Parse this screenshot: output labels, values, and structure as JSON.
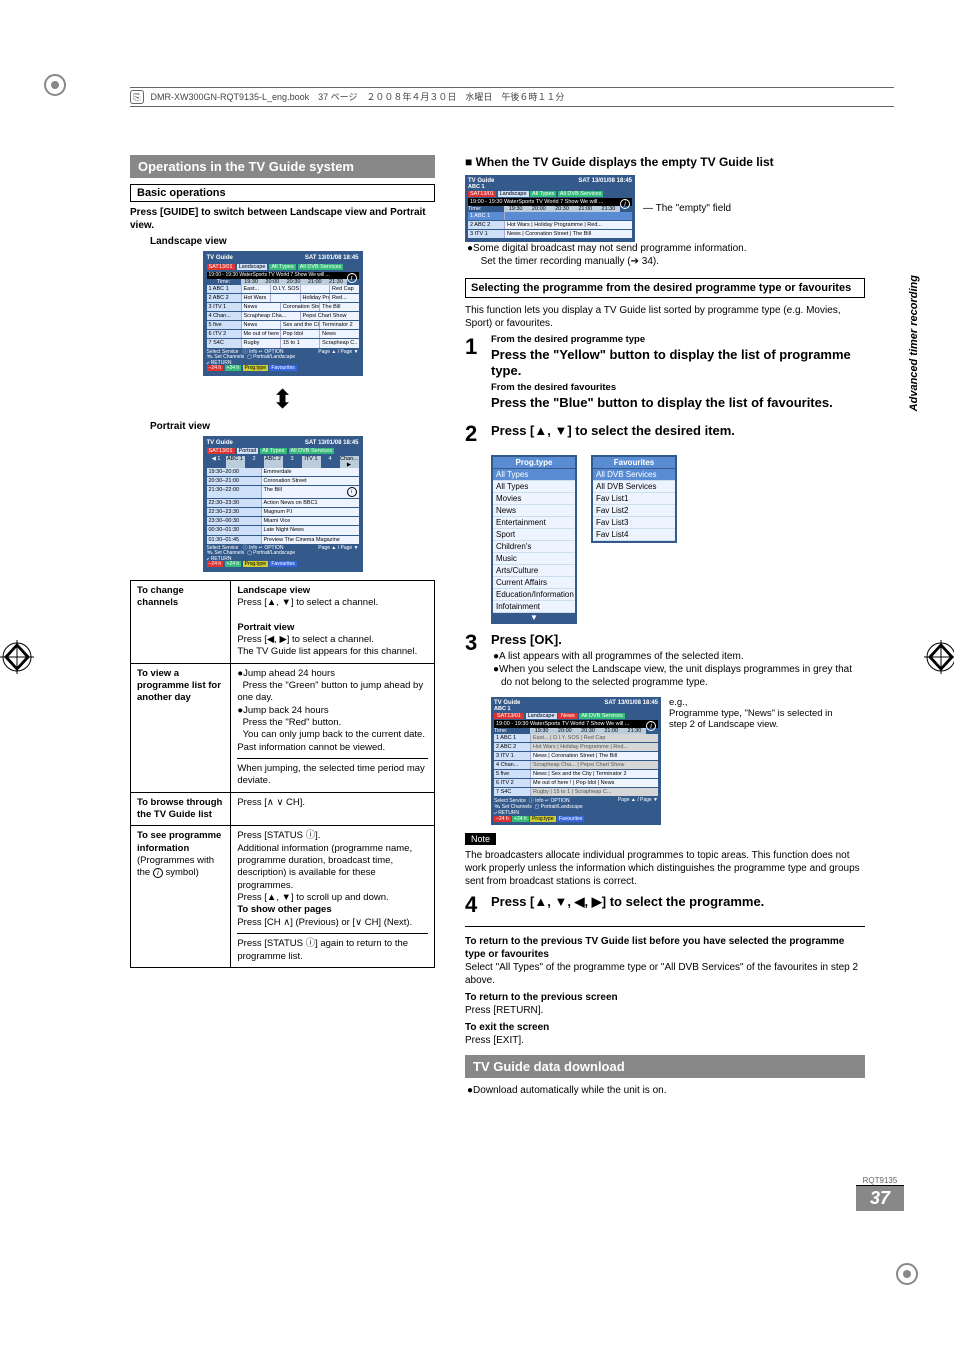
{
  "header_strip": "DMR-XW300GN-RQT9135-L_eng.book　37 ページ　２００８年４月３０日　水曜日　午後６時１１分",
  "side_label": "Advanced timer recording",
  "rqt": "RQT9135",
  "page_num": "37",
  "left": {
    "title": "Operations in the TV Guide system",
    "basic_ops": "Basic operations",
    "press_guide": "Press [GUIDE] to switch between Landscape view and Portrait view.",
    "landscape_label": "Landscape view",
    "portrait_label": "Portrait view",
    "table": {
      "r1l": "To change channels",
      "r1a_h": "Landscape view",
      "r1a": "Press [▲, ▼] to select a channel.",
      "r1b_h": "Portrait view",
      "r1b": "Press [◀, ▶] to select a channel.",
      "r1c": "The TV Guide list appears for this channel.",
      "r2l": "To view a programme list for another day",
      "r2a": "Jump ahead 24 hours",
      "r2b": "Press the \"Green\" button to jump ahead by one day.",
      "r2c": "Jump back 24 hours",
      "r2d": "Press the \"Red\" button.",
      "r2e": "You can only jump back to the current date. Past information cannot be viewed.",
      "r2f": "When jumping, the selected time period may deviate.",
      "r3l": "To browse through the TV Guide list",
      "r3r": "Press [∧ ∨ CH].",
      "r4l": "To see programme information (Programmes with the ⓘ symbol)",
      "r4a": "Press [STATUS ⓘ].",
      "r4b": "Additional information (programme name, programme duration, broadcast time, description) is available for these programmes.",
      "r4c": "Press [▲, ▼] to scroll up and down.",
      "r4d": "To show other pages",
      "r4e": "Press [CH ∧] (Previous) or [∨ CH] (Next).",
      "r4f": "Press [STATUS ⓘ] again to return to the programme list."
    }
  },
  "tg_landscape": {
    "title": "TV Guide",
    "datetime": "SAT 13/01/08 18:45",
    "filter_date": "SAT13/01",
    "filter_view": "Landscape",
    "filter_type": "All Types",
    "filter_svc": "All DVB Services",
    "info_line": "19:00 - 19:30 WaterSports TV World 7 Show We will ...",
    "time_label": "Time:",
    "times": [
      "19:30",
      "20:00",
      "20:30",
      "21:00",
      "21:30"
    ],
    "rows": [
      {
        "n": "1",
        "ch": "ABC 1",
        "p": [
          "East...",
          "D.I.Y. SOS",
          "",
          "Red Cap"
        ]
      },
      {
        "n": "2",
        "ch": "ABC 2",
        "p": [
          "Hot Wars",
          "",
          "Holiday Programme",
          "Red..."
        ]
      },
      {
        "n": "3",
        "ch": "ITV 1",
        "p": [
          "News",
          "Coronation Street",
          "The Bill"
        ]
      },
      {
        "n": "4",
        "ch": "Chan...",
        "p": [
          "Scrapheap Cha...",
          "Pepsi Chart Show"
        ]
      },
      {
        "n": "5",
        "ch": "five",
        "p": [
          "News",
          "Sex and the City",
          "Terminator 2"
        ]
      },
      {
        "n": "6",
        "ch": "ITV 2",
        "p": [
          "Me out of here !",
          "Pop Idol",
          "News"
        ]
      },
      {
        "n": "7",
        "ch": "S4C",
        "p": [
          "Rugby",
          "15 to 1",
          "Scrapheap C..."
        ]
      }
    ],
    "ftr1": "Select Service",
    "ftr2": "Set Channels",
    "ftr_info": "ⓘ Info  ↵ OPTION",
    "ftr_view": "▢ Portrait/Landscape",
    "ftr_page": "Page ▲ / Page ▼",
    "ftr_return": "⤶ RETURN",
    "btn_m24": "−24 h",
    "btn_p24": "+24 h",
    "btn_pt": "Prog.type",
    "btn_fav": "Favourites"
  },
  "tg_portrait": {
    "title": "TV Guide",
    "datetime": "SAT 13/01/08 18:45",
    "filter_date": "SAT13/01",
    "filter_view": "Portrait",
    "filter_type": "All Types",
    "filter_svc": "All DVB Services",
    "ch_row": [
      "◀ 1",
      "ABC 1",
      "2",
      "ABC 2",
      "3",
      "ITV 1",
      "4",
      "Chan... ▶"
    ],
    "rows": [
      {
        "t": "19:30–20:00",
        "p": "Emmerdale"
      },
      {
        "t": "20:30–21:00",
        "p": "Coronation Street"
      },
      {
        "t": "21:30–22:00",
        "p": "The Bill"
      },
      {
        "t": "22:30–23:30",
        "p": "Action News on BBC1"
      },
      {
        "t": "22:30–23:30",
        "p": "Magnum P.I"
      },
      {
        "t": "23:30–00:30",
        "p": "Miami Vice"
      },
      {
        "t": "00:30–01:30",
        "p": "Late Night News"
      },
      {
        "t": "01:30–01:45",
        "p": "Preview    The Cinema Magazine"
      }
    ]
  },
  "right": {
    "empty_h": "When the TV Guide displays the empty TV Guide list",
    "empty_callout": "The \"empty\" field",
    "empty_b1": "Some digital broadcast may not send programme information.",
    "empty_b2": "Set the timer recording manually (➔ 34).",
    "sel_h": "Selecting the programme from the desired programme type or favourites",
    "sel_p": "This function lets you display a TV Guide list sorted by programme type (e.g. Movies, Sport) or favourites.",
    "s1a": "From the desired programme type",
    "s1b": "Press the \"Yellow\" button to display the list of programme type.",
    "s1c": "From the desired favourites",
    "s1d": "Press the \"Blue\" button to display the list of favourites.",
    "s2": "Press [▲, ▼] to select the desired item.",
    "menu_left_h": "Prog.type",
    "menu_left": [
      "All Types",
      "All Types",
      "Movies",
      "News",
      "Entertainment",
      "Sport",
      "Children's",
      "Music",
      "Arts/Culture",
      "Current Affairs",
      "Education/Information",
      "Infotainment"
    ],
    "menu_right_h": "Favourites",
    "menu_right": [
      "All DVB Services",
      "All DVB Services",
      "Fav List1",
      "Fav List2",
      "Fav List3",
      "Fav List4"
    ],
    "s3": "Press [OK].",
    "s3b1": "A list appears with all programmes of the selected item.",
    "s3b2": "When you select the Landscape view, the unit displays programmes in grey that do not belong to the selected programme type.",
    "eg": "e.g.,",
    "eg2": "Programme type, \"News\" is selected in step 2 of Landscape view.",
    "note": "Note",
    "note_p": "The broadcasters allocate individual programmes to topic areas. This function does not work properly unless the information which distinguishes the programme type and groups sent from broadcast stations is correct.",
    "s4": "Press [▲, ▼, ◀, ▶] to select the programme.",
    "ret1h": "To return to the previous TV Guide list before you have selected the programme type or favourites",
    "ret1": "Select \"All Types\" of the programme type or \"All DVB Services\" of the favourites in step 2 above.",
    "ret2h": "To return to the previous screen",
    "ret2": "Press [RETURN].",
    "ret3h": "To exit the screen",
    "ret3": "Press [EXIT].",
    "dl_h": "TV Guide data download",
    "dl_p": "Download automatically while the unit is on."
  },
  "tg_empty": {
    "title": "TV Guide",
    "ch": "ABC 1",
    "datetime": "SAT 13/01/08 18:45",
    "filter_date": "SAT13/01",
    "filter_view": "Landscape",
    "filter_type": "All Types",
    "filter_svc": "All DVB Services",
    "info": "19:00 - 19:30 WaterSports TV World 7 Show We will ...",
    "times": [
      "19:30",
      "20:00",
      "20:30",
      "21:00",
      "21:30"
    ],
    "rows": [
      {
        "n": "1",
        "ch": "ABC 1",
        "p": ""
      },
      {
        "n": "2",
        "ch": "ABC 2",
        "p": "Hot Wars | Holiday Programme | Red..."
      },
      {
        "n": "3",
        "ch": "ITV 1",
        "p": "News | Coronation Street | The Bill"
      }
    ]
  },
  "tg_news": {
    "title": "TV Guide",
    "ch": "ABC 1",
    "datetime": "SAT 13/01/08 18:45",
    "filter_date": "SAT13/01",
    "filter_view": "Landscape",
    "filter_type": "News",
    "filter_svc": "All DVB Services",
    "info": "19:00 - 19:30 WaterSports TV World 7 Show We will ...",
    "times": [
      "19:30",
      "20:00",
      "20:30",
      "21:00",
      "21:30"
    ],
    "rows": [
      {
        "n": "1",
        "ch": "ABC 1",
        "p": "East... | D.I.Y. SOS | Red Cap",
        "on": false
      },
      {
        "n": "2",
        "ch": "ABC 2",
        "p": "Hot Wars | Holiday Programme | Red...",
        "on": false
      },
      {
        "n": "3",
        "ch": "ITV 1",
        "p": "News | Coronation Street | The Bill",
        "on": true
      },
      {
        "n": "4",
        "ch": "Chan...",
        "p": "Scrapheap Cha... | Pepsi Chart Show",
        "on": false
      },
      {
        "n": "5",
        "ch": "five",
        "p": "News | Sex and the City | Terminator 2",
        "on": true
      },
      {
        "n": "6",
        "ch": "ITV 2",
        "p": "Me out of here ! | Pop Idol | News",
        "on": true
      },
      {
        "n": "7",
        "ch": "S4C",
        "p": "Rugby | 15 to 1 | Scrapheap C...",
        "on": false
      }
    ]
  }
}
